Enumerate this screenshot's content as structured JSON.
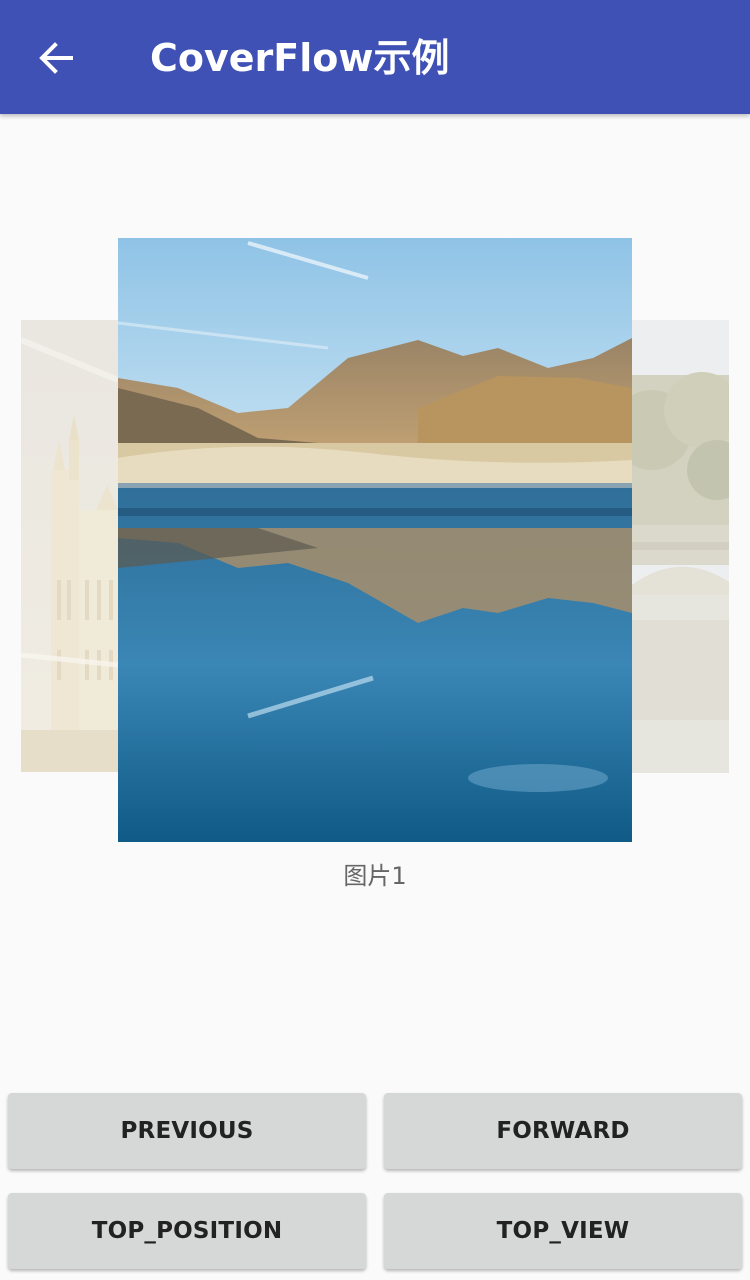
{
  "app_bar": {
    "title": "CoverFlow示例",
    "back_icon": "arrow-left-icon",
    "background_color": "#3f51b5"
  },
  "cover_flow": {
    "caption": "图片1",
    "covers": [
      {
        "position": "left",
        "subject": "palace-tower-image"
      },
      {
        "position": "center",
        "subject": "mountain-lake-reflection-image"
      },
      {
        "position": "right",
        "subject": "bridge-river-trees-image"
      }
    ]
  },
  "buttons": {
    "previous": "PREVIOUS",
    "forward": "FORWARD",
    "top_position": "TOP_POSITION",
    "top_view": "TOP_VIEW"
  }
}
